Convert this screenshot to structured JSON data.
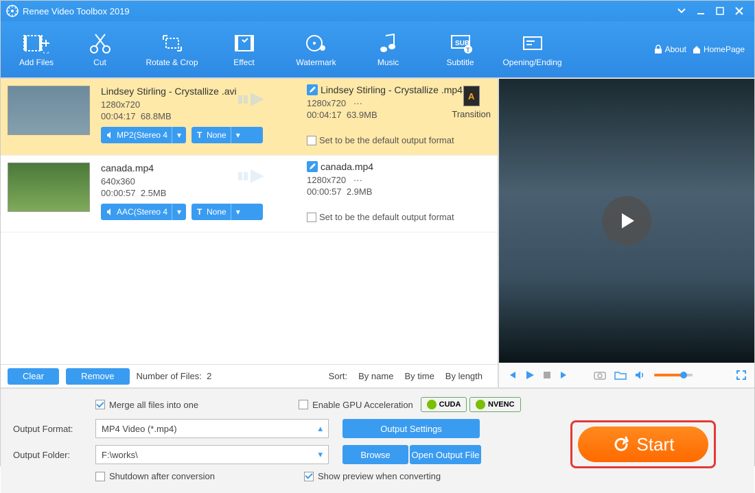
{
  "window_title": "Renee Video Toolbox 2019",
  "toolbar": [
    {
      "label": "Add Files"
    },
    {
      "label": "Cut"
    },
    {
      "label": "Rotate & Crop"
    },
    {
      "label": "Effect"
    },
    {
      "label": "Watermark"
    },
    {
      "label": "Music"
    },
    {
      "label": "Subtitle"
    },
    {
      "label": "Opening/Ending"
    }
  ],
  "top_links": {
    "about": "About",
    "homepage": "HomePage"
  },
  "files": [
    {
      "in_name": "Lindsey Stirling - Crystallize .avi",
      "in_res": "1280x720",
      "in_dur": "00:04:17",
      "in_size": "68.8MB",
      "audio_chip": "MP2(Stereo 4",
      "sub_chip": "None",
      "out_name": "Lindsey Stirling - Crystallize .mp4",
      "out_res": "1280x720",
      "out_dur": "00:04:17",
      "out_size": "63.9MB",
      "default_label": "Set to be the default output format",
      "transition_label": "Transition"
    },
    {
      "in_name": "canada.mp4",
      "in_res": "640x360",
      "in_dur": "00:00:57",
      "in_size": "2.5MB",
      "audio_chip": "AAC(Stereo 4",
      "sub_chip": "None",
      "out_name": "canada.mp4",
      "out_res": "1280x720",
      "out_dur": "00:00:57",
      "out_size": "2.9MB",
      "default_label": "Set to be the default output format"
    }
  ],
  "listfooter": {
    "clear": "Clear",
    "remove": "Remove",
    "count_label": "Number of Files:",
    "count_value": "2",
    "sort_label": "Sort:",
    "sort_byname": "By name",
    "sort_bytime": "By time",
    "sort_bylength": "By length"
  },
  "bottom": {
    "merge": "Merge all files into one",
    "gpu": "Enable GPU Acceleration",
    "cuda": "CUDA",
    "nvenc": "NVENC",
    "format_label": "Output Format:",
    "format_value": "MP4 Video (*.mp4)",
    "folder_label": "Output Folder:",
    "folder_value": "F:\\works\\",
    "output_settings": "Output Settings",
    "browse": "Browse",
    "open_output": "Open Output File",
    "shutdown": "Shutdown after conversion",
    "show_preview": "Show preview when converting",
    "start": "Start"
  },
  "other": {
    "dots": "···",
    "t_prefix": "T"
  }
}
